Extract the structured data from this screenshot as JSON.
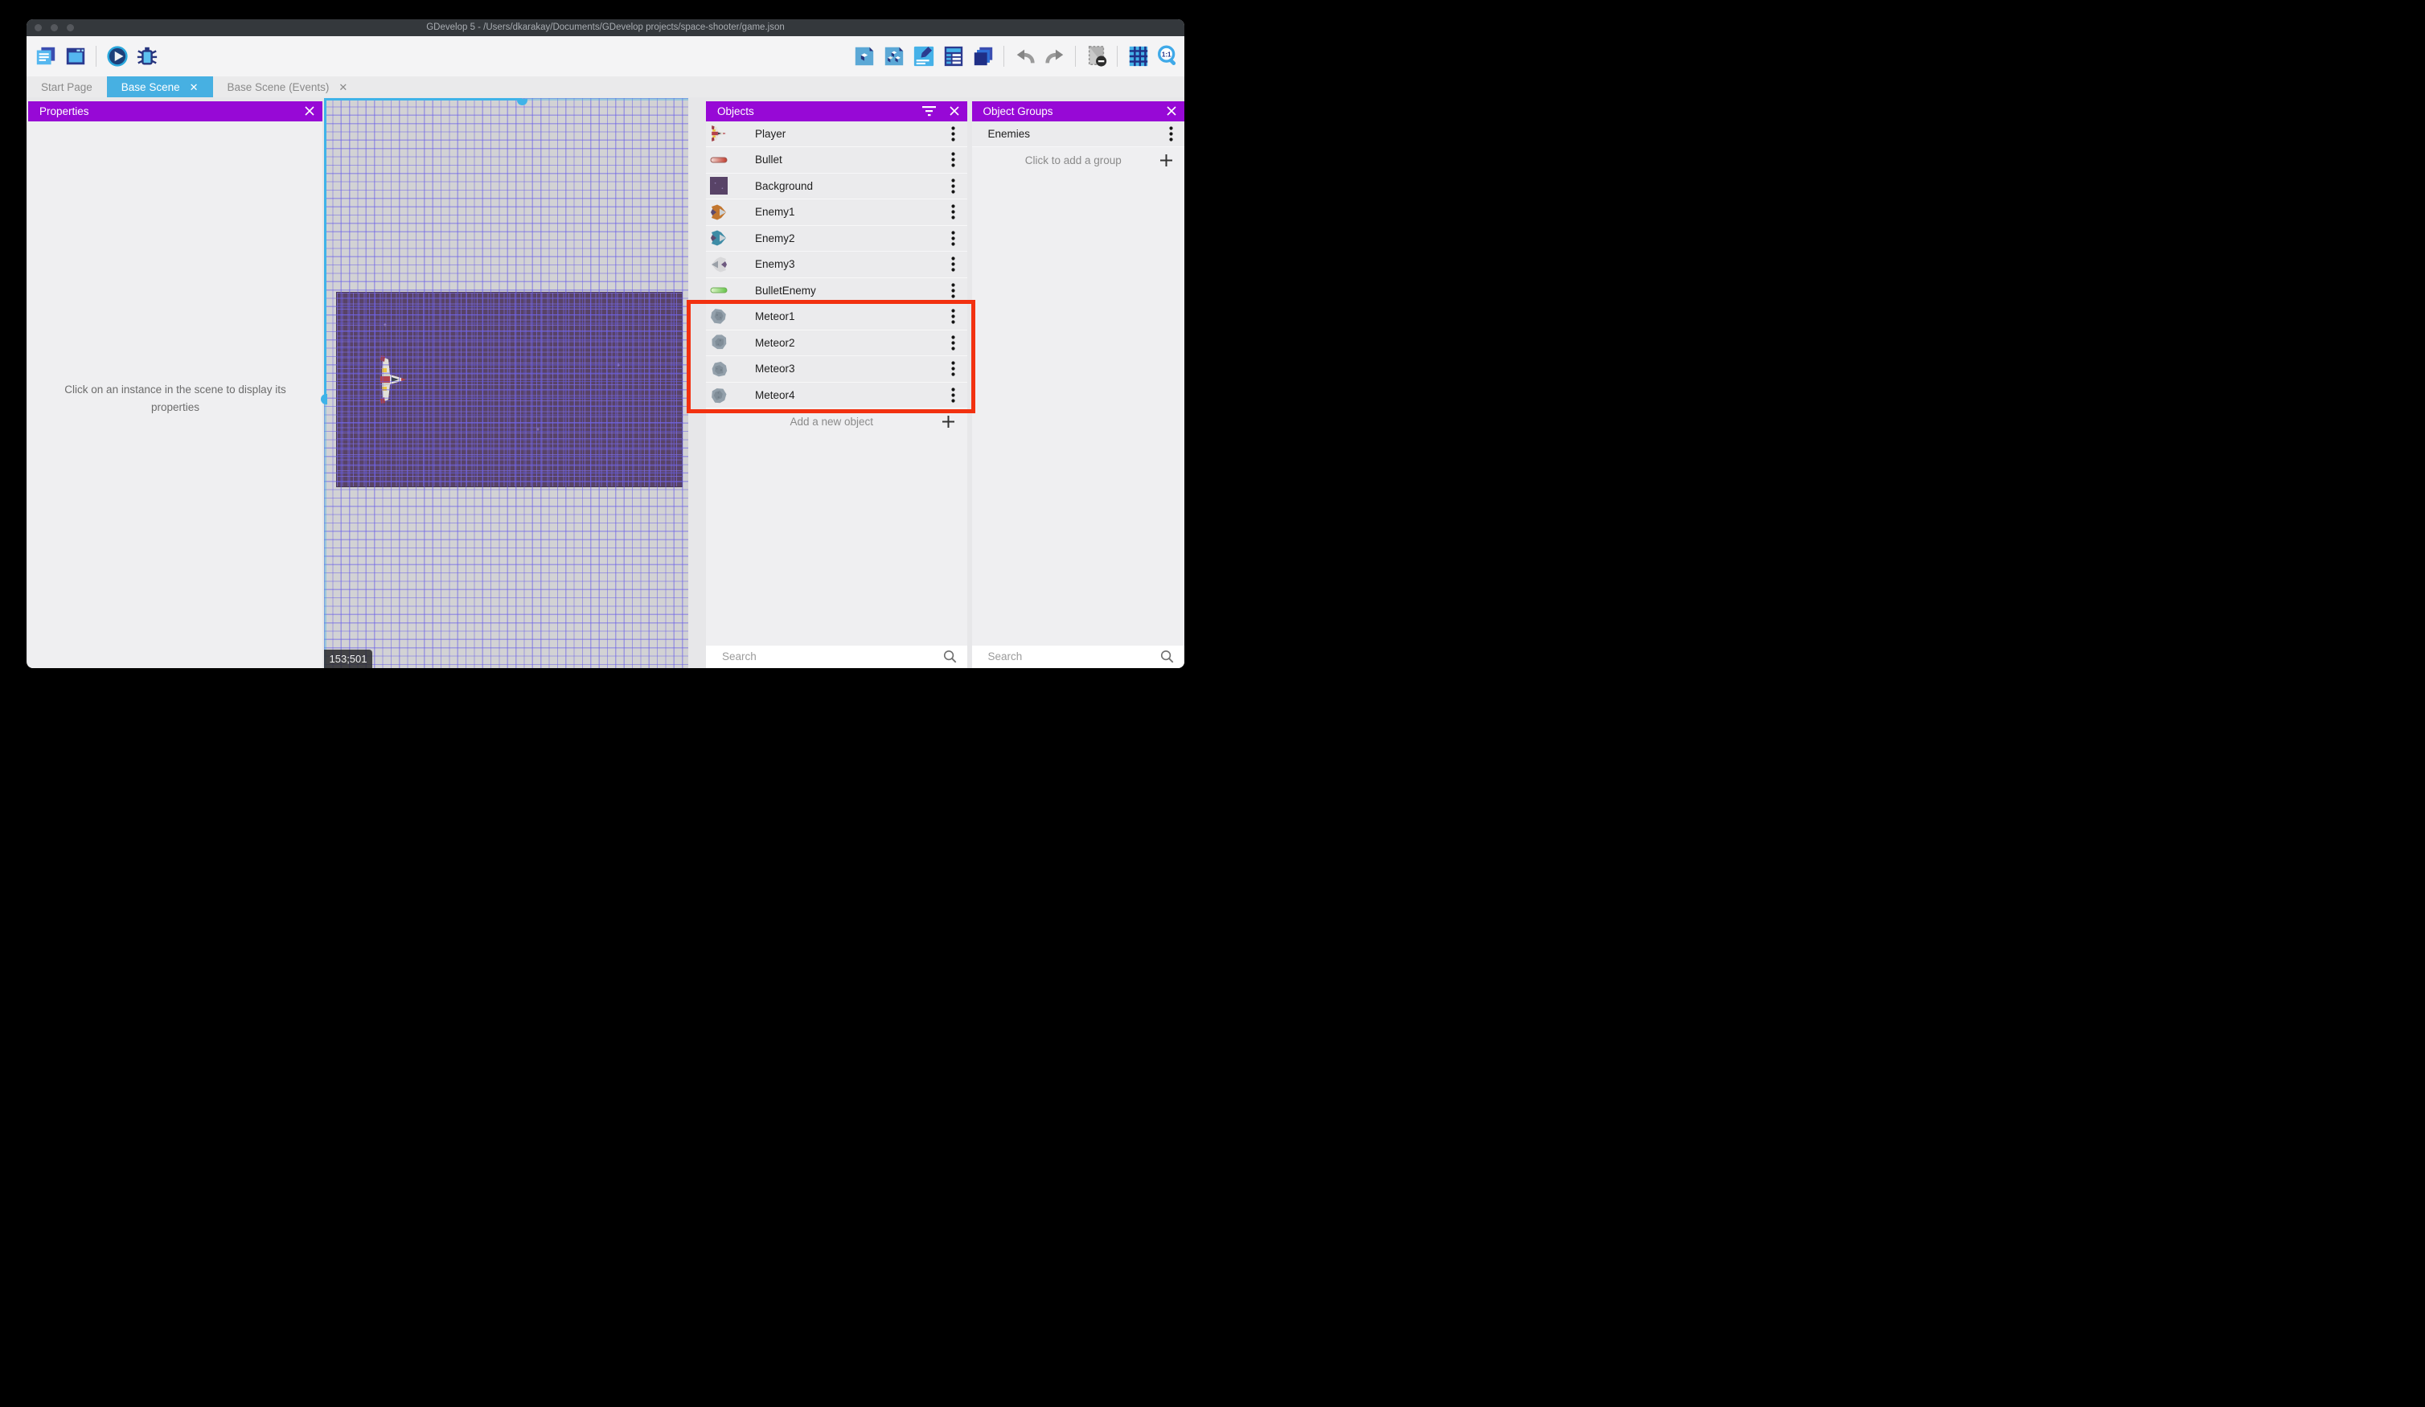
{
  "window_title": "GDevelop 5 - /Users/dkarakay/Documents/GDevelop projects/space-shooter/game.json",
  "tabs": [
    {
      "label": "Start Page",
      "active": false,
      "closable": false
    },
    {
      "label": "Base Scene",
      "active": true,
      "closable": true
    },
    {
      "label": "Base Scene (Events)",
      "active": false,
      "closable": true
    }
  ],
  "toolbar": {
    "left_icons": [
      "project-manager",
      "preview-window",
      "divider",
      "play",
      "debug"
    ],
    "right_icons": [
      "objects-editor",
      "object-groups-editor",
      "scene-properties",
      "instances-list",
      "layers",
      "divider",
      "undo",
      "redo",
      "divider",
      "mask",
      "divider",
      "grid",
      "zoom-1-1"
    ]
  },
  "properties_panel": {
    "title": "Properties",
    "empty_message": "Click on an instance in the scene to display its properties"
  },
  "scene": {
    "coordinate_badge": "153;501"
  },
  "objects_panel": {
    "title": "Objects",
    "add_label": "Add a new object",
    "search_placeholder": "Search",
    "objects": [
      {
        "name": "Player",
        "icon": "player",
        "highlighted": false
      },
      {
        "name": "Bullet",
        "icon": "bullet",
        "highlighted": false
      },
      {
        "name": "Background",
        "icon": "background",
        "highlighted": false
      },
      {
        "name": "Enemy1",
        "icon": "enemy1",
        "highlighted": false
      },
      {
        "name": "Enemy2",
        "icon": "enemy2",
        "highlighted": false
      },
      {
        "name": "Enemy3",
        "icon": "enemy3",
        "highlighted": false
      },
      {
        "name": "BulletEnemy",
        "icon": "bullet-enemy",
        "highlighted": false
      },
      {
        "name": "Meteor1",
        "icon": "meteor1",
        "highlighted": true
      },
      {
        "name": "Meteor2",
        "icon": "meteor2",
        "highlighted": true
      },
      {
        "name": "Meteor3",
        "icon": "meteor3",
        "highlighted": true
      },
      {
        "name": "Meteor4",
        "icon": "meteor4",
        "highlighted": true
      }
    ]
  },
  "groups_panel": {
    "title": "Object Groups",
    "groups": [
      {
        "name": "Enemies"
      }
    ],
    "add_label": "Click to add a group",
    "search_placeholder": "Search"
  },
  "colors": {
    "panel_header_purple": "#9709d6",
    "active_tab_blue": "#47b0e2",
    "selection_cyan": "#3fb3e8",
    "highlight_red": "#f23110",
    "scene_background": "#d2d2d4",
    "background_object_purple": "#584367",
    "titlebar": "#34383c"
  }
}
